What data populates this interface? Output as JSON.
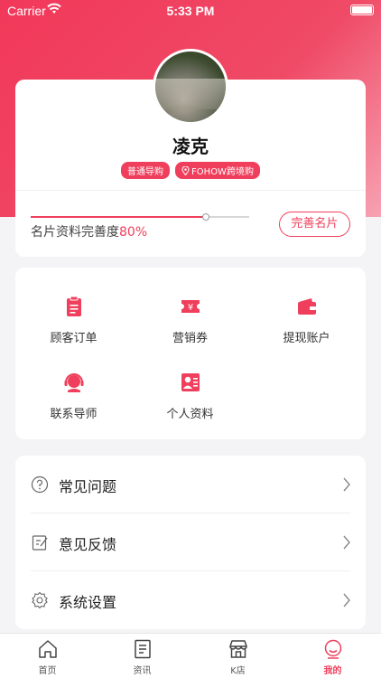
{
  "status_bar": {
    "carrier": "Carrier",
    "time": "5:33 PM"
  },
  "profile": {
    "name": "凌克",
    "tags": [
      "普通导购",
      "FOHOW跨境购"
    ],
    "completeness_label": "名片资料完善度",
    "completeness_value": "80%",
    "complete_button": "完善名片"
  },
  "grid": [
    {
      "label": "顾客订单",
      "icon": "clipboard-icon"
    },
    {
      "label": "营销券",
      "icon": "coupon-icon"
    },
    {
      "label": "提现账户",
      "icon": "wallet-icon"
    },
    {
      "label": "联系导师",
      "icon": "headset-icon"
    },
    {
      "label": "个人资料",
      "icon": "id-card-icon"
    }
  ],
  "list": [
    {
      "label": "常见问题",
      "icon": "question-icon"
    },
    {
      "label": "意见反馈",
      "icon": "feedback-icon"
    },
    {
      "label": "系统设置",
      "icon": "gear-icon"
    }
  ],
  "tabs": [
    {
      "label": "首页",
      "icon": "home-icon"
    },
    {
      "label": "资讯",
      "icon": "news-icon"
    },
    {
      "label": "K店",
      "icon": "store-icon"
    },
    {
      "label": "我的",
      "icon": "user-icon",
      "active": true
    }
  ],
  "colors": {
    "accent": "#ef3f5c"
  }
}
